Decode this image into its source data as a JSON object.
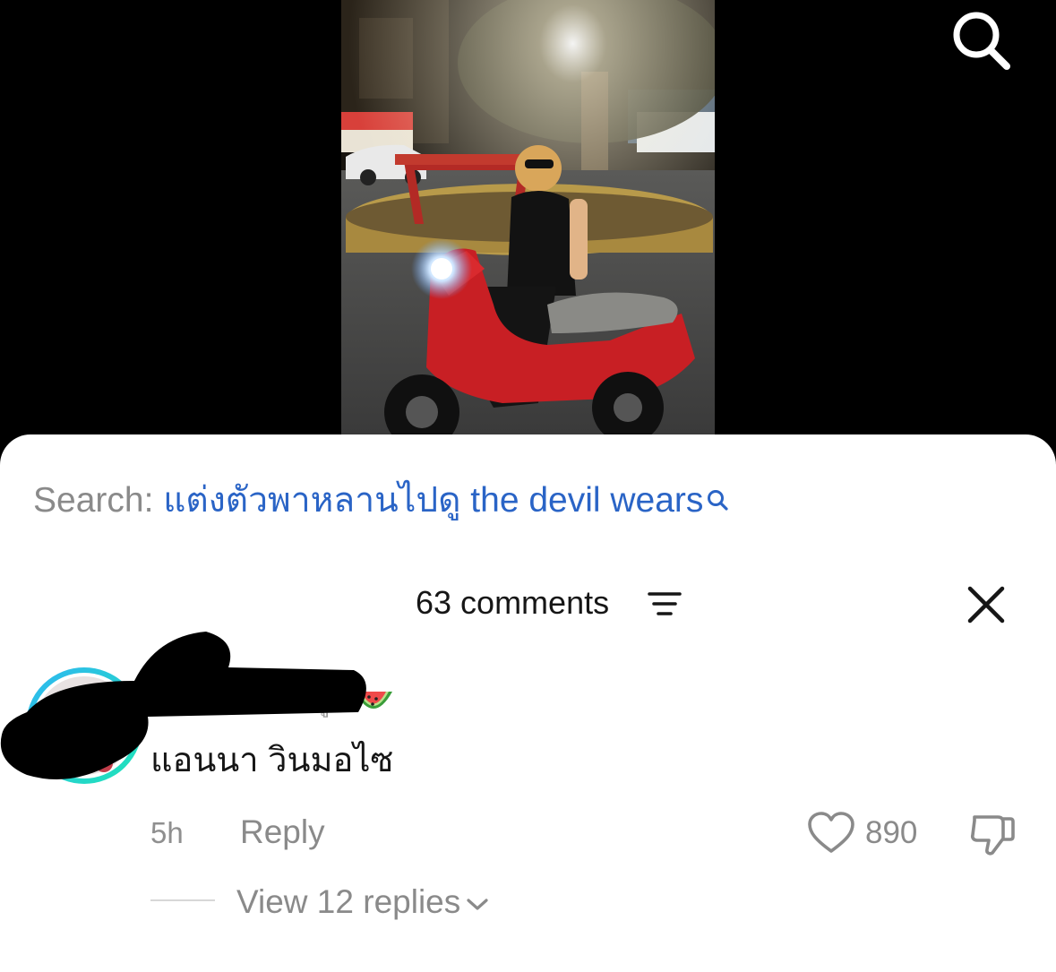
{
  "video": {
    "description_icon": "search-icon"
  },
  "search_suggestion": {
    "prefix": "Search: ",
    "query": "แต่งตัวพาหลานไปดู the devil wears",
    "icon": "search-icon"
  },
  "comments_header": {
    "title": "63 comments",
    "filter_icon": "filter-icon",
    "close_icon": "close-icon"
  },
  "comment": {
    "username_emoji": "watermelon",
    "text": "แอนนา วินมอไซ",
    "time": "5h",
    "reply_label": "Reply",
    "likes": "890",
    "view_replies_label": "View 12 replies"
  },
  "colors": {
    "link_blue": "#2a64c6",
    "muted_gray": "#8a8a8a",
    "avatar_ring_start": "#2fb8f0",
    "avatar_ring_end": "#1fe3b9",
    "scooter_red": "#c81f24"
  }
}
